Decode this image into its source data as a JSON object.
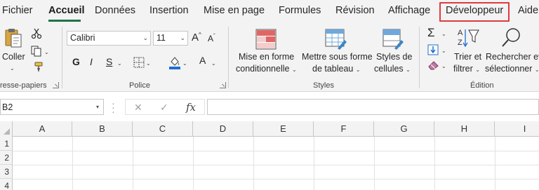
{
  "tabs": [
    "Fichier",
    "Accueil",
    "Données",
    "Insertion",
    "Mise en page",
    "Formules",
    "Révision",
    "Affichage",
    "Développeur",
    "Aide"
  ],
  "active_tab": "Accueil",
  "highlighted_tab": "Développeur",
  "colors": {
    "accent": "#217346",
    "highlight_box": "#e0393e"
  },
  "clipboard": {
    "paste_label": "Coller",
    "group_label": "resse-papiers"
  },
  "font": {
    "font_name": "Calibri",
    "font_size": "11",
    "bold": "G",
    "italic": "I",
    "underline": "S",
    "grow": "A",
    "shrink": "A",
    "font_color": "A",
    "group_label": "Police"
  },
  "styles": {
    "conditional_line1": "Mise en forme",
    "conditional_line2": "conditionnelle",
    "table_line1": "Mettre sous forme",
    "table_line2": "de tableau",
    "cell_line1": "Styles de",
    "cell_line2": "cellules",
    "group_label": "Styles"
  },
  "editing": {
    "sort_line1": "Trier et",
    "sort_line2": "filtrer",
    "find_line1": "Rechercher et",
    "find_line2": "sélectionner",
    "group_label": "Édition"
  },
  "formula_bar": {
    "name_box": "B2",
    "cancel_icon": "✕",
    "enter_icon": "✓",
    "fx": "fx",
    "value": ""
  },
  "grid": {
    "columns": [
      "A",
      "B",
      "C",
      "D",
      "E",
      "F",
      "G",
      "H",
      "I"
    ],
    "rows": [
      "1",
      "2",
      "3",
      "4"
    ]
  }
}
